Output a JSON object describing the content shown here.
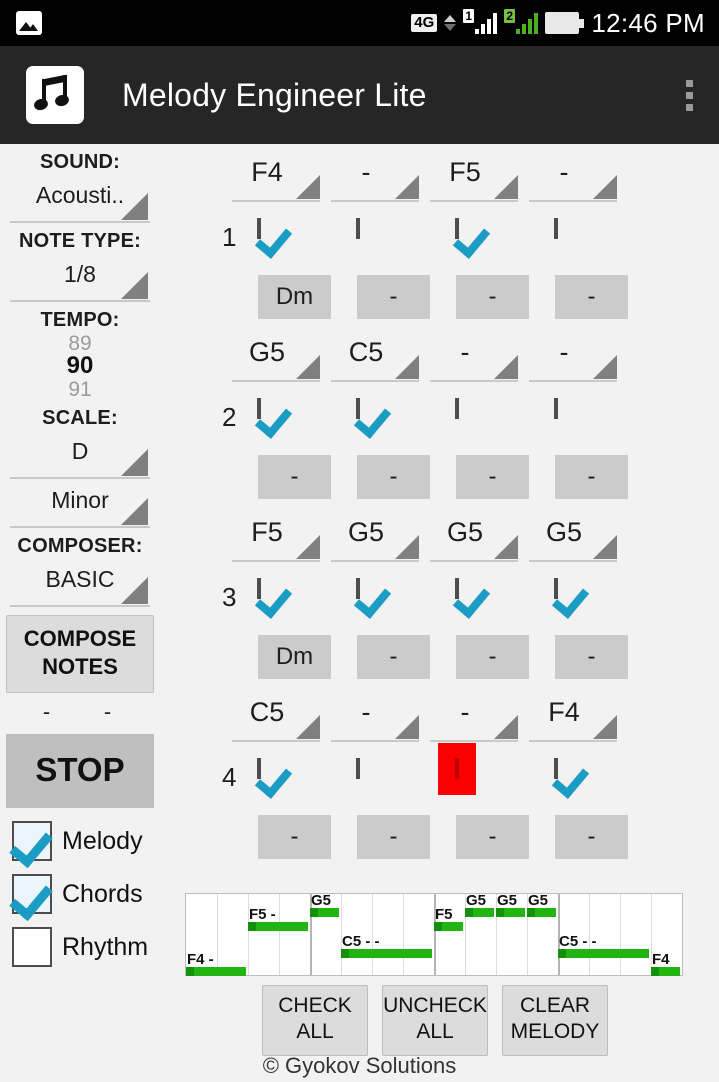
{
  "statusbar": {
    "gallery_icon": "image-icon",
    "network_label": "4G",
    "sim1_label": "1",
    "sim2_label": "2",
    "battery_icon": "battery-icon",
    "clock": "12:46 PM"
  },
  "actionbar": {
    "app_icon": "music-note-icon",
    "title": "Melody Engineer Lite",
    "overflow_icon": "overflow-menu-icon"
  },
  "sidebar": {
    "sound_label": "SOUND:",
    "sound_value": "Acousti..",
    "note_type_label": "NOTE TYPE:",
    "note_type_value": "1/8",
    "tempo_label": "TEMPO:",
    "tempo_prev": "89",
    "tempo_current": "90",
    "tempo_next": "91",
    "scale_label": "SCALE:",
    "scale_key_value": "D",
    "scale_mode_value": "Minor",
    "composer_label": "COMPOSER:",
    "composer_value": "BASIC",
    "compose_button": "COMPOSE NOTES",
    "status_left": "-",
    "status_right": "-",
    "stop_button": "STOP",
    "toggles": [
      {
        "label": "Melody",
        "checked": true
      },
      {
        "label": "Chords",
        "checked": true
      },
      {
        "label": "Rhythm",
        "checked": false
      }
    ]
  },
  "grid": {
    "rows": [
      {
        "number": "1",
        "notes": [
          "F4",
          "-",
          "F5",
          "-"
        ],
        "checks": [
          true,
          false,
          true,
          false
        ],
        "highlight": [
          false,
          false,
          false,
          false
        ],
        "chords": [
          "Dm",
          "-",
          "-",
          "-"
        ]
      },
      {
        "number": "2",
        "notes": [
          "G5",
          "C5",
          "-",
          "-"
        ],
        "checks": [
          true,
          true,
          false,
          false
        ],
        "highlight": [
          false,
          false,
          false,
          false
        ],
        "chords": [
          "-",
          "-",
          "-",
          "-"
        ]
      },
      {
        "number": "3",
        "notes": [
          "F5",
          "G5",
          "G5",
          "G5"
        ],
        "checks": [
          true,
          true,
          true,
          true
        ],
        "highlight": [
          false,
          false,
          false,
          false
        ],
        "chords": [
          "Dm",
          "-",
          "-",
          "-"
        ]
      },
      {
        "number": "4",
        "notes": [
          "C5",
          "-",
          "-",
          "F4"
        ],
        "checks": [
          true,
          false,
          false,
          true
        ],
        "highlight": [
          false,
          false,
          true,
          false
        ],
        "chords": [
          "-",
          "-",
          "-",
          "-"
        ]
      }
    ]
  },
  "piano_roll": {
    "notes": [
      {
        "label": "F4",
        "tail": "-",
        "start": 0,
        "span": 2,
        "row": 5
      },
      {
        "label": "F5",
        "tail": "-",
        "start": 2,
        "span": 2,
        "row": 2
      },
      {
        "label": "G5",
        "tail": "",
        "start": 4,
        "span": 1,
        "row": 1
      },
      {
        "label": "C5",
        "tail": "- -",
        "start": 5,
        "span": 3,
        "row": 4
      },
      {
        "label": "F5",
        "tail": "",
        "start": 8,
        "span": 1,
        "row": 2
      },
      {
        "label": "G5",
        "tail": "",
        "start": 9,
        "span": 1,
        "row": 1
      },
      {
        "label": "G5",
        "tail": "",
        "start": 10,
        "span": 1,
        "row": 1
      },
      {
        "label": "G5",
        "tail": "",
        "start": 11,
        "span": 1,
        "row": 1
      },
      {
        "label": "C5",
        "tail": "- -",
        "start": 12,
        "span": 3,
        "row": 4
      },
      {
        "label": "F4",
        "tail": "",
        "start": 15,
        "span": 1,
        "row": 5
      }
    ],
    "columns": 16,
    "bars": 4
  },
  "bottom_buttons": [
    "CHECK ALL",
    "UNCHECK ALL",
    "CLEAR MELODY"
  ],
  "footer": "© Gyokov Solutions",
  "colors": {
    "accent_check": "#1b9cc4",
    "highlight": "#fb0000",
    "note_green": "#22b511",
    "actionbar": "#262626",
    "background": "#f2f2f2"
  }
}
